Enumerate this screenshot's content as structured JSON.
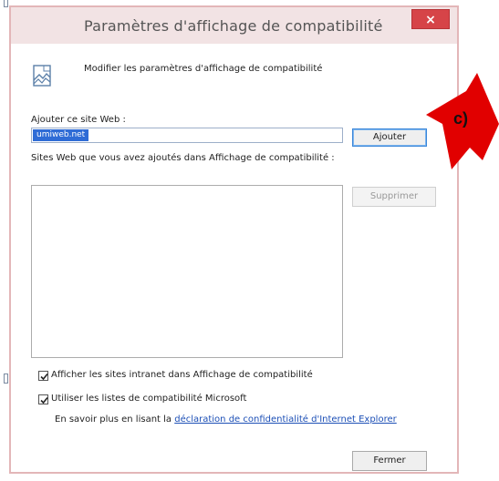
{
  "window": {
    "title": "Paramètres d'affichage de compatibilité",
    "close_glyph": "×"
  },
  "header": {
    "text": "Modifier les paramètres d'affichage de compatibilité",
    "icon": "compatibility-view-icon"
  },
  "add_site": {
    "label": "Ajouter ce site Web :",
    "value": "umiweb.net",
    "button_label": "Ajouter"
  },
  "sites_list": {
    "label": "Sites Web que vous avez ajoutés dans Affichage de compatibilité :",
    "items": [],
    "remove_label": "Supprimer"
  },
  "options": {
    "intranet": {
      "label": "Afficher les sites intranet dans Affichage de compatibilité",
      "checked": true
    },
    "microsoft_lists": {
      "label": "Utiliser les listes de compatibilité Microsoft",
      "checked": true
    },
    "privacy_prefix": "En savoir plus en lisant la ",
    "privacy_link": "déclaration de confidentialité d'Internet Explorer"
  },
  "footer": {
    "close_label": "Fermer"
  },
  "annotation": {
    "label": "c)",
    "color": "#e10000"
  },
  "colors": {
    "close_button": "#d64448",
    "selection": "#2f6cd6",
    "link": "#1c4fb6"
  }
}
